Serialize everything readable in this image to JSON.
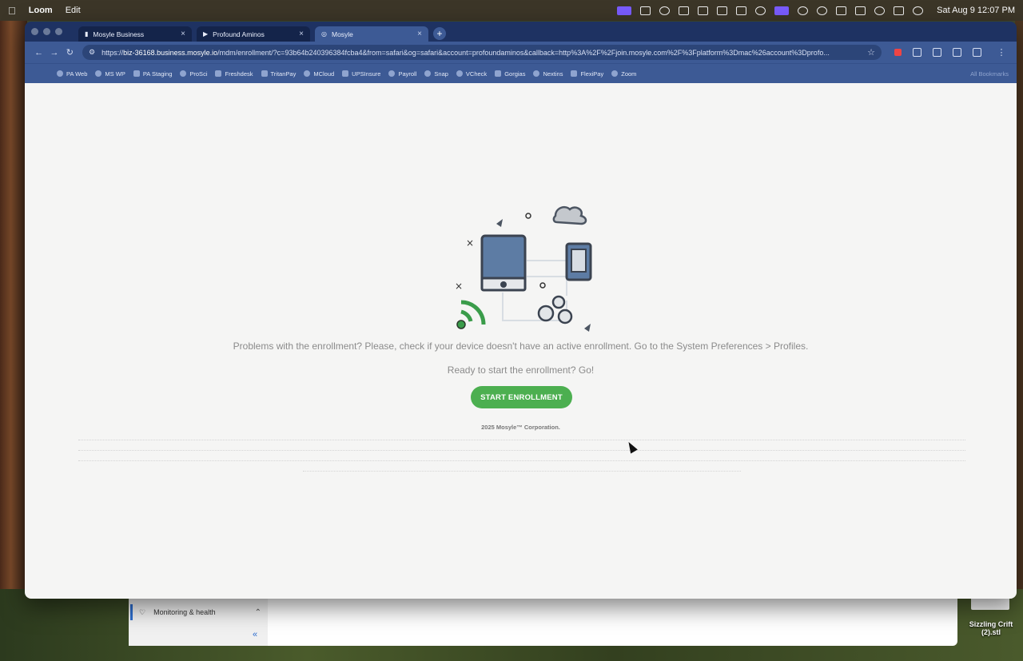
{
  "menubar": {
    "app_name": "Loom",
    "menus": [
      "Edit"
    ],
    "clock": "Sat Aug 9  12:07 PM"
  },
  "browser": {
    "tabs": [
      {
        "label": "Mosyle Business",
        "active": false
      },
      {
        "label": "Profound Aminos",
        "active": false
      },
      {
        "label": "Mosyle",
        "active": true
      }
    ],
    "url_prefix": "https://",
    "url_host": "biz-36168.business.mosyle.io",
    "url_rest": "/mdm/enrollment/?c=93b64b240396384fcba4&from=safari&og=safari&account=profoundaminos&callback=http%3A%2F%2Fjoin.mosyle.com%2F%3Fplatform%3Dmac%26account%3Dprofo...",
    "bookmarks": [
      "PA Web",
      "MS WP",
      "PA Staging",
      "ProSci",
      "Freshdesk",
      "TritanPay",
      "MCloud",
      "UPSInsure",
      "Payroll",
      "Snap",
      "VCheck",
      "Gorgias",
      "Nextins",
      "FlexiPay",
      "Zoom"
    ],
    "all_bookmarks": "All Bookmarks"
  },
  "page": {
    "problem_text": "Problems with the enrollment? Please, check if your device doesn't have an active enrollment. Go to the System Preferences > Profiles.",
    "ready_text": "Ready to start the enrollment? Go!",
    "start_button": "START ENROLLMENT",
    "copyright": "2025 Mosyle™ Corporation."
  },
  "back_app": {
    "sidebar_item": "Monitoring & health",
    "collapse": "«"
  },
  "desktop_file": "Sizzling Crift (2).stl",
  "colors": {
    "button_green": "#4caf50",
    "chrome_blue": "#3d5a95",
    "tab_strip": "#1e3262"
  }
}
